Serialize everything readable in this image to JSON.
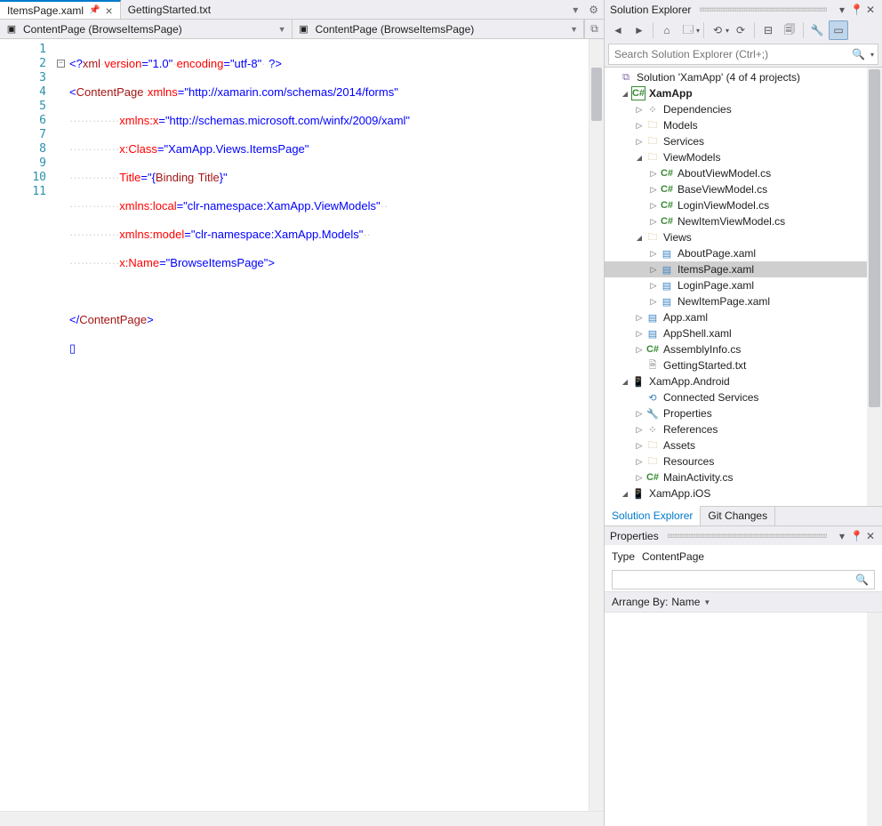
{
  "tabs": [
    {
      "label": "ItemsPage.xaml",
      "pinned": true,
      "active": true
    },
    {
      "label": "GettingStarted.txt",
      "pinned": false,
      "active": false
    }
  ],
  "nav_left": "ContentPage (BrowseItemsPage)",
  "nav_right": "ContentPage (BrowseItemsPage)",
  "code_lines": [
    "1",
    "2",
    "3",
    "4",
    "5",
    "6",
    "7",
    "8",
    "9",
    "10",
    "11"
  ],
  "code": {
    "l1": {
      "pre": "<?",
      "tag": "xml",
      "a1": "version",
      "v1": "\"1.0\"",
      "a2": "encoding",
      "v2": "\"utf-8\"",
      "end": " ?>"
    },
    "l2": {
      "open": "<",
      "tag": "ContentPage",
      "attr": "xmlns",
      "val": "\"http://xamarin.com/schemas/2014/forms\""
    },
    "l3": {
      "attr": "xmlns:x",
      "val": "\"http://schemas.microsoft.com/winfx/2009/xaml\""
    },
    "l4": {
      "attr": "x:Class",
      "val": "\"XamApp.Views.ItemsPage\""
    },
    "l5": {
      "attr": "Title",
      "val": "\"{",
      "b1": "Binding",
      "b2": "Title",
      "vend": "}\""
    },
    "l6": {
      "attr": "xmlns:local",
      "val": "\"clr-namespace:XamApp.ViewModels\""
    },
    "l7": {
      "attr": "xmlns:model",
      "val": "\"clr-namespace:XamApp.Models\""
    },
    "l8": {
      "attr": "x:Name",
      "val": "\"BrowseItemsPage\"",
      "close": ">"
    },
    "l10": {
      "open": "</",
      "tag": "ContentPage",
      "close": ">"
    }
  },
  "se": {
    "title": "Solution Explorer",
    "search_ph": "Search Solution Explorer (Ctrl+;)",
    "root": "Solution 'XamApp' (4 of 4 projects)",
    "proj1": "XamApp",
    "deps": "Dependencies",
    "models": "Models",
    "services": "Services",
    "viewmodels": "ViewModels",
    "about_vm": "AboutViewModel.cs",
    "base_vm": "BaseViewModel.cs",
    "login_vm": "LoginViewModel.cs",
    "newitem_vm": "NewItemViewModel.cs",
    "views": "Views",
    "about_pg": "AboutPage.xaml",
    "items_pg": "ItemsPage.xaml",
    "login_pg": "LoginPage.xaml",
    "newitem_pg": "NewItemPage.xaml",
    "app": "App.xaml",
    "appshell": "AppShell.xaml",
    "asm": "AssemblyInfo.cs",
    "getting": "GettingStarted.txt",
    "proj2": "XamApp.Android",
    "connserv": "Connected Services",
    "props": "Properties",
    "refs": "References",
    "assets": "Assets",
    "resources": "Resources",
    "mainact": "MainActivity.cs",
    "proj3": "XamApp.iOS"
  },
  "bottom_tabs": {
    "se": "Solution Explorer",
    "git": "Git Changes"
  },
  "properties": {
    "title": "Properties",
    "type_lbl": "Type",
    "type_val": "ContentPage",
    "arrange": "Arrange By:",
    "arrange_val": "Name"
  }
}
